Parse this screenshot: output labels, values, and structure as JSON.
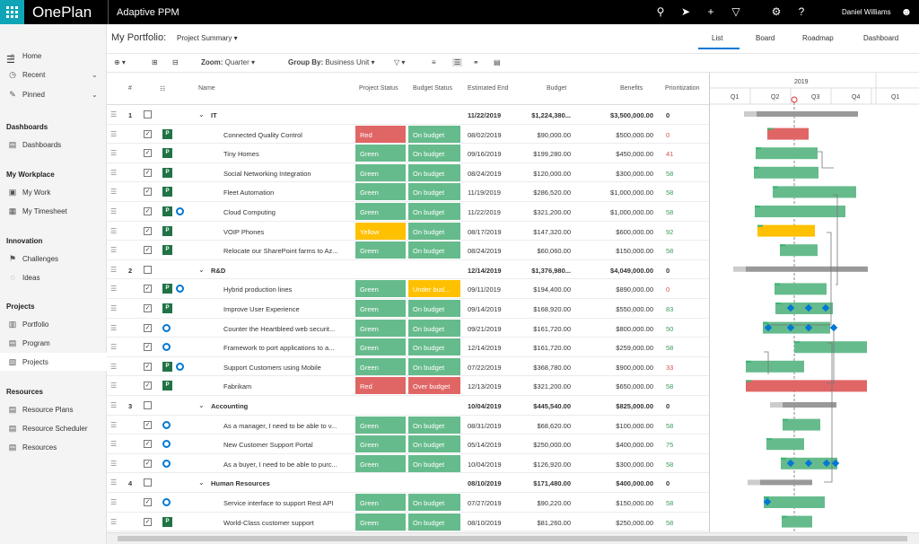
{
  "app": {
    "brand": "OnePlan",
    "name": "Adaptive PPM",
    "user": "Daniel Williams"
  },
  "sidebar": {
    "top": [
      {
        "icon": "home-icon",
        "label": "Home"
      },
      {
        "icon": "clock-icon",
        "label": "Recent"
      },
      {
        "icon": "pin-icon",
        "label": "Pinned"
      }
    ],
    "sections": [
      {
        "title": "Dashboards",
        "items": [
          "Dashboards"
        ]
      },
      {
        "title": "My Workplace",
        "items": [
          "My Work",
          "My Timesheet"
        ]
      },
      {
        "title": "Innovation",
        "items": [
          "Challenges",
          "Ideas"
        ]
      },
      {
        "title": "Projects",
        "items": [
          "Portfolio",
          "Program",
          "Projects"
        ]
      },
      {
        "title": "Resources",
        "items": [
          "Resource Plans",
          "Resource Scheduler",
          "Resources"
        ]
      }
    ]
  },
  "page": {
    "title": "My Portfolio:",
    "view": "Project Summary"
  },
  "view_tabs": [
    "List",
    "Board",
    "Roadmap",
    "Dashboard"
  ],
  "toolbar": {
    "zoom_label": "Zoom:",
    "zoom_value": "Quarter",
    "group_label": "Group By:",
    "group_value": "Business Unit"
  },
  "columns": {
    "num": "#",
    "name": "Name",
    "project_status": "Project Status",
    "budget_status": "Budget Status",
    "end": "Estimated End",
    "budget": "Budget",
    "benefits": "Benefits",
    "priority": "Prioritization"
  },
  "gantt": {
    "year": "2019",
    "quarters": [
      "Q1",
      "Q2",
      "Q3",
      "Q4",
      "Q1"
    ]
  },
  "colors": {
    "green": "#66bb8c",
    "red": "#e06666",
    "yellow": "#ffc000",
    "orange": "#ffc000",
    "bar_gray": "#999999",
    "blue": "#0078d4"
  },
  "rows": [
    {
      "type": "group",
      "num": "1",
      "name": "IT",
      "end": "11/22/2019",
      "budget": "$1,224,380...",
      "benefits": "$3,500,000.00",
      "priority": "0"
    },
    {
      "type": "item",
      "icons": "g",
      "name": "Connected Quality Control",
      "ps": "Red",
      "bs": "On budget",
      "end": "08/02/2019",
      "budget": "$90,000.00",
      "benefits": "$500,000.00",
      "priority": "0"
    },
    {
      "type": "item",
      "icons": "g",
      "name": "Tiny Homes",
      "ps": "Green",
      "bs": "On budget",
      "end": "09/16/2019",
      "budget": "$199,280.00",
      "benefits": "$450,000.00",
      "priority": "41"
    },
    {
      "type": "item",
      "icons": "g",
      "name": "Social Networking Integration",
      "ps": "Green",
      "bs": "On budget",
      "end": "08/24/2019",
      "budget": "$120,000.00",
      "benefits": "$300,000.00",
      "priority": "58"
    },
    {
      "type": "item",
      "icons": "g",
      "name": "Fleet Automation",
      "ps": "Green",
      "bs": "On budget",
      "end": "11/19/2019",
      "budget": "$286,520.00",
      "benefits": "$1,000,000.00",
      "priority": "58"
    },
    {
      "type": "item",
      "icons": "gb",
      "name": "Cloud Computing",
      "ps": "Green",
      "bs": "On budget",
      "end": "11/22/2019",
      "budget": "$321,200.00",
      "benefits": "$1,000,000.00",
      "priority": "58"
    },
    {
      "type": "item",
      "icons": "g",
      "name": "VOIP Phones",
      "ps": "Yellow",
      "bs": "On budget",
      "end": "08/17/2019",
      "budget": "$147,320.00",
      "benefits": "$600,000.00",
      "priority": "92"
    },
    {
      "type": "item",
      "icons": "g",
      "name": "Relocate our SharePoint farms to Az...",
      "ps": "Green",
      "bs": "On budget",
      "end": "08/24/2019",
      "budget": "$60,060.00",
      "benefits": "$150,000.00",
      "priority": "58"
    },
    {
      "type": "group",
      "num": "2",
      "name": "R&D",
      "end": "12/14/2019",
      "budget": "$1,376,980...",
      "benefits": "$4,049,000.00",
      "priority": "0"
    },
    {
      "type": "item",
      "icons": "gb",
      "name": "Hybrid production lines",
      "ps": "Green",
      "bs": "Under bud...",
      "end": "09/11/2019",
      "budget": "$194,400.00",
      "benefits": "$890,000.00",
      "priority": "0"
    },
    {
      "type": "item",
      "icons": "g",
      "name": "Improve User Experience",
      "ps": "Green",
      "bs": "On budget",
      "end": "09/14/2019",
      "budget": "$168,920.00",
      "benefits": "$550,000.00",
      "priority": "83"
    },
    {
      "type": "item",
      "icons": "b",
      "name": "Counter the Heartbleed web securit...",
      "ps": "Green",
      "bs": "On budget",
      "end": "09/21/2019",
      "budget": "$161,720.00",
      "benefits": "$800,000.00",
      "priority": "50"
    },
    {
      "type": "item",
      "icons": "b",
      "name": "Framework to port applications to a...",
      "ps": "Green",
      "bs": "On budget",
      "end": "12/14/2019",
      "budget": "$161,720.00",
      "benefits": "$259,000.00",
      "priority": "58"
    },
    {
      "type": "item",
      "icons": "gb",
      "name": "Support Customers using Mobile",
      "ps": "Green",
      "bs": "On budget",
      "end": "07/22/2019",
      "budget": "$368,780.00",
      "benefits": "$900,000.00",
      "priority": "33"
    },
    {
      "type": "item",
      "icons": "g",
      "name": "Fabrikam",
      "ps": "Red",
      "bs": "Over budget",
      "end": "12/13/2019",
      "budget": "$321,200.00",
      "benefits": "$650,000.00",
      "priority": "58"
    },
    {
      "type": "group",
      "num": "3",
      "name": "Accounting",
      "end": "10/04/2019",
      "budget": "$445,540.00",
      "benefits": "$825,000.00",
      "priority": "0"
    },
    {
      "type": "item",
      "icons": "b",
      "name": "As a manager, I need to be able to v...",
      "ps": "Green",
      "bs": "On budget",
      "end": "08/31/2019",
      "budget": "$68,620.00",
      "benefits": "$100,000.00",
      "priority": "58"
    },
    {
      "type": "item",
      "icons": "b",
      "name": "New Customer Support Portal",
      "ps": "Green",
      "bs": "On budget",
      "end": "05/14/2019",
      "budget": "$250,000.00",
      "benefits": "$400,000.00",
      "priority": "75"
    },
    {
      "type": "item",
      "icons": "b",
      "name": "As a buyer, I need to be able to purc...",
      "ps": "Green",
      "bs": "On budget",
      "end": "10/04/2019",
      "budget": "$126,920.00",
      "benefits": "$300,000.00",
      "priority": "58"
    },
    {
      "type": "group",
      "num": "4",
      "name": "Human Resources",
      "end": "08/10/2019",
      "budget": "$171,480.00",
      "benefits": "$400,000.00",
      "priority": "0"
    },
    {
      "type": "item",
      "icons": "b",
      "name": "Service interface to support Rest API",
      "ps": "Green",
      "bs": "On budget",
      "end": "07/27/2019",
      "budget": "$90,220.00",
      "benefits": "$150,000.00",
      "priority": "58"
    },
    {
      "type": "item",
      "icons": "g",
      "name": "World-Class customer support",
      "ps": "Green",
      "bs": "On budget",
      "end": "08/10/2019",
      "budget": "$81,260.00",
      "benefits": "$250,000.00",
      "priority": "58"
    }
  ]
}
